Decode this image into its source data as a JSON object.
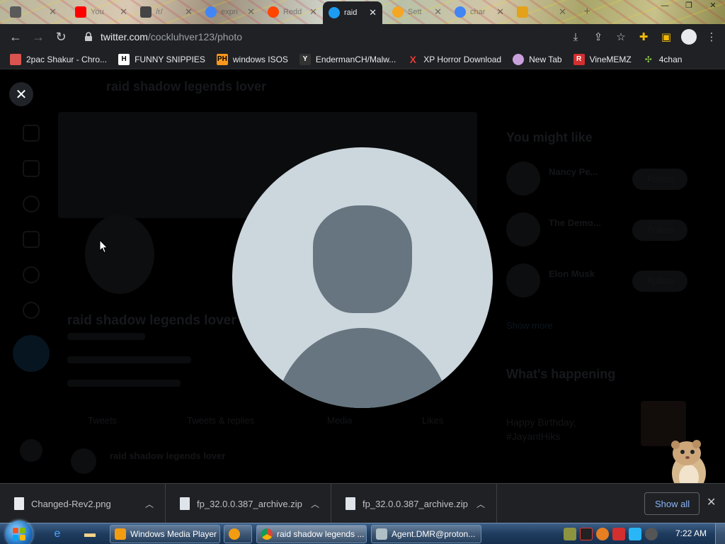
{
  "browser": {
    "tabs": [
      {
        "label": "",
        "fav_color": "#5a5a5a"
      },
      {
        "label": "You",
        "fav_color": "#ff0000"
      },
      {
        "label": "/r/",
        "fav_color": "#444444"
      },
      {
        "label": "expn",
        "fav_color": "#4285f4"
      },
      {
        "label": "Redd",
        "fav_color": "#ff4500"
      },
      {
        "label": "raid",
        "fav_color": "#1d9bf0",
        "active": true
      },
      {
        "label": "Sett",
        "fav_color": "#f5a623"
      },
      {
        "label": "char",
        "fav_color": "#4285f4"
      },
      {
        "label": "",
        "fav_color": "#e3a21a"
      }
    ],
    "url_host": "twitter.com",
    "url_path": "/cockluhver123/photo"
  },
  "bookmarks": [
    {
      "label": "2pac Shakur - Chro...",
      "icon_text": "",
      "color": "#d9534f"
    },
    {
      "label": "FUNNY SNIPPIES",
      "icon_text": "H",
      "color": "#ffffff"
    },
    {
      "label": "windows ISOS",
      "icon_text": "PH",
      "color": "#f7971d"
    },
    {
      "label": "EndermanCH/Malw...",
      "icon_text": "Y",
      "color": "#444444"
    },
    {
      "label": "XP Horror Download",
      "icon_text": "X",
      "color": "#e53935"
    },
    {
      "label": "New Tab",
      "icon_text": "",
      "color": "#c9a0dc"
    },
    {
      "label": "VineMEMZ",
      "icon_text": "R",
      "color": "#d32f2f"
    },
    {
      "label": "4chan",
      "icon_text": "",
      "color": "#8bc34a"
    }
  ],
  "page": {
    "profile_name": "raid shadow legends lover",
    "sidebar_heading": "You might like",
    "suggestions": [
      {
        "name": "Nancy Pe...",
        "follow": "Follow"
      },
      {
        "name": "The Demo...",
        "follow": "Follow"
      },
      {
        "name": "Elon Musk",
        "follow": "Follow"
      }
    ],
    "show_more": "Show more",
    "whats_happening": "What's happening",
    "trend_text": "Happy Birthday, #JayantHiks",
    "tabs": [
      "Tweets",
      "Tweets & replies",
      "Media",
      "Likes"
    ]
  },
  "downloads": {
    "items": [
      {
        "name": "Changed-Rev2.png",
        "type": "png"
      },
      {
        "name": "fp_32.0.0.387_archive.zip",
        "type": "zip"
      },
      {
        "name": "fp_32.0.0.387_archive.zip",
        "type": "zip"
      }
    ],
    "show_all": "Show all"
  },
  "taskbar": {
    "tasks": [
      {
        "label": "Windows Media Player",
        "color": "#f39c12"
      },
      {
        "label": "",
        "color": "#f39c12"
      },
      {
        "label": "raid shadow legends ...",
        "color": "#4285f4"
      },
      {
        "label": "Agent.DMR@proton...",
        "color": "#b0bec5"
      }
    ],
    "clock": "7:22 AM"
  }
}
